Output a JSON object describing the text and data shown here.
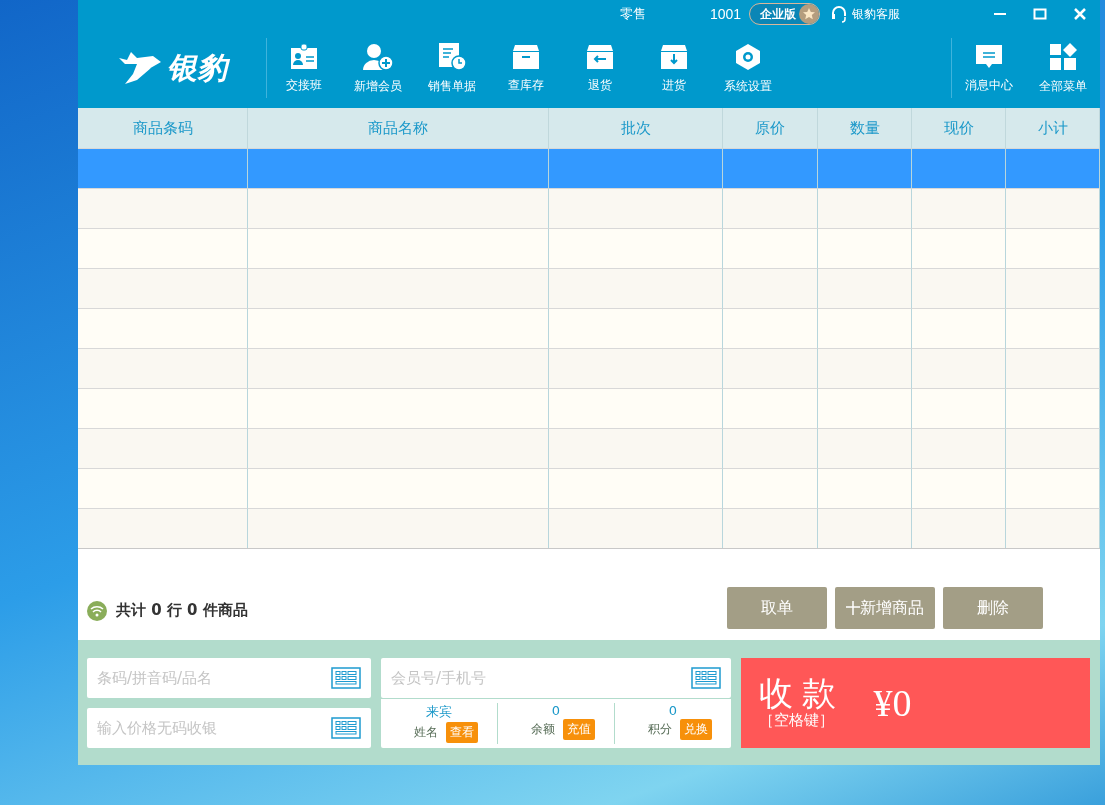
{
  "title_bar": {
    "mode": "零售",
    "store_number": "1001",
    "edition_badge": "企业版",
    "support_link": "银豹客服"
  },
  "logo": {
    "text": "银豹"
  },
  "toolbar": [
    {
      "label": "交接班",
      "kind": "badge"
    },
    {
      "label": "新增会员",
      "kind": "useradd"
    },
    {
      "label": "销售单据",
      "kind": "receipt"
    },
    {
      "label": "查库存",
      "kind": "box"
    },
    {
      "label": "退货",
      "kind": "return"
    },
    {
      "label": "进货",
      "kind": "restock"
    },
    {
      "label": "系统设置",
      "kind": "settings"
    }
  ],
  "toolbar_right": [
    {
      "label": "消息中心",
      "kind": "message"
    },
    {
      "label": "全部菜单",
      "kind": "menu"
    }
  ],
  "table": {
    "columns": [
      "商品条码",
      "商品名称",
      "批次",
      "原价",
      "数量",
      "现价",
      "小计"
    ],
    "rows": [
      {
        "selected": true
      },
      {
        "selected": false
      },
      {
        "selected": false
      },
      {
        "selected": false
      },
      {
        "selected": false
      },
      {
        "selected": false
      },
      {
        "selected": false
      },
      {
        "selected": false
      },
      {
        "selected": false
      },
      {
        "selected": false
      }
    ]
  },
  "summary": "共计 0 行 0 件商品",
  "actions": [
    {
      "label": "取单",
      "kind": "plain"
    },
    {
      "label": "新增商品",
      "kind": "add"
    },
    {
      "label": "删除",
      "kind": "plain"
    }
  ],
  "barcode_field": {
    "placeholder": "条码/拼音码/品名"
  },
  "price_field": {
    "placeholder": "输入价格无码收银"
  },
  "member": {
    "placeholder": "会员号/手机号",
    "stats": [
      {
        "value": "来宾",
        "label": "姓名",
        "action": "查看"
      },
      {
        "value": "0",
        "label": "余额",
        "action": "充值"
      },
      {
        "value": "0",
        "label": "积分",
        "action": "兑换"
      }
    ]
  },
  "checkout": {
    "label": "收 款",
    "hint": "［空格键］",
    "amount": "¥0"
  }
}
